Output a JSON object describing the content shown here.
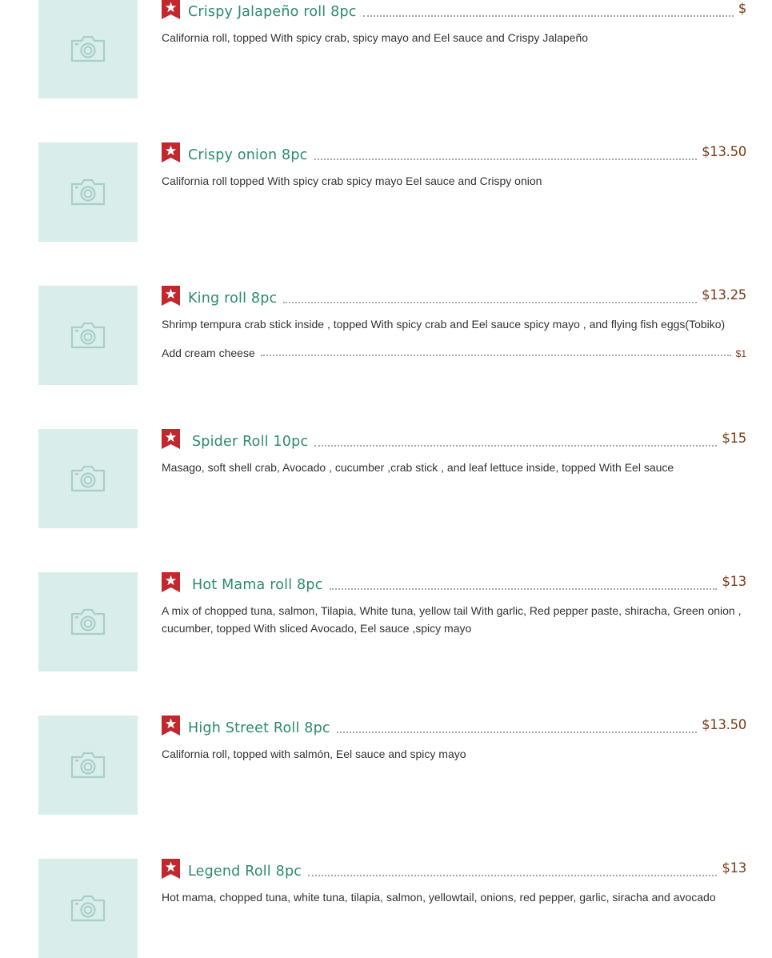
{
  "colors": {
    "item_name": "#2c8a6f",
    "price": "#7a3b17",
    "description": "#333333",
    "photo_placeholder_bg": "#d9edea",
    "photo_placeholder_icon": "#a9cfca",
    "badge": "#c1272d"
  },
  "icons": {
    "photo": "camera-icon",
    "badge": "star-badge-icon"
  },
  "menu_items": [
    {
      "name": "Crispy Jalapeño roll 8pc",
      "price": "$",
      "description": "California roll, topped With spicy crab, spicy mayo and Eel sauce and Crispy Jalapeño"
    },
    {
      "name": "Crispy onion 8pc",
      "price": "$13.50",
      "description": "California roll topped With spicy crab spicy mayo Eel sauce and Crispy onion"
    },
    {
      "name": "King roll 8pc",
      "price": "$13.25",
      "description": "Shrimp tempura crab stick inside , topped With spicy crab and Eel sauce spicy mayo , and flying fish eggs(Tobiko)",
      "addon": {
        "label": "Add cream cheese",
        "price": "$1"
      }
    },
    {
      "name": "Spider Roll 10pc",
      "price": "$15",
      "description": "Masago, soft shell crab, Avocado , cucumber ,crab stick , and leaf lettuce inside, topped With Eel sauce"
    },
    {
      "name": "Hot Mama roll 8pc",
      "price": "$13",
      "description": "A mix of chopped tuna, salmon, Tilapia, White tuna, yellow tail With garlic, Red pepper paste, shiracha, Green onion , cucumber, topped With sliced Avocado, Eel sauce ,spicy mayo"
    },
    {
      "name": "High Street Roll 8pc",
      "price": "$13.50",
      "description": "California roll, topped with salmón, Eel sauce and spicy mayo"
    },
    {
      "name": "Legend Roll 8pc",
      "price": "$13",
      "description": "Hot mama, chopped tuna, white tuna, tilapia, salmon, yellowtail, onions, red pepper, garlic, siracha and avocado"
    }
  ]
}
